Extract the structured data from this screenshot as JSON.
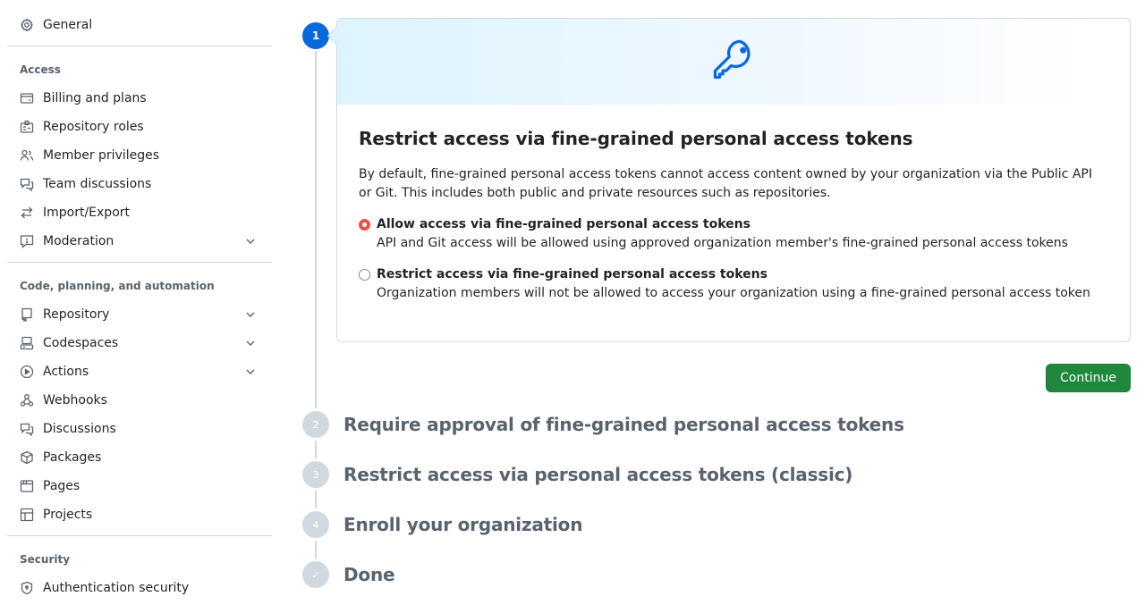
{
  "sidebar": {
    "top_item": {
      "label": "General",
      "icon": "gear-icon"
    },
    "sections": [
      {
        "heading": "Access",
        "items": [
          {
            "label": "Billing and plans",
            "icon": "credit-card-icon",
            "expandable": false
          },
          {
            "label": "Repository roles",
            "icon": "id-badge-icon",
            "expandable": false
          },
          {
            "label": "Member privileges",
            "icon": "people-icon",
            "expandable": false
          },
          {
            "label": "Team discussions",
            "icon": "comment-discussion-icon",
            "expandable": false
          },
          {
            "label": "Import/Export",
            "icon": "arrow-switch-icon",
            "expandable": false
          },
          {
            "label": "Moderation",
            "icon": "report-icon",
            "expandable": true
          }
        ]
      },
      {
        "heading": "Code, planning, and automation",
        "items": [
          {
            "label": "Repository",
            "icon": "repo-icon",
            "expandable": true
          },
          {
            "label": "Codespaces",
            "icon": "codespaces-icon",
            "expandable": true
          },
          {
            "label": "Actions",
            "icon": "play-icon",
            "expandable": true
          },
          {
            "label": "Webhooks",
            "icon": "webhook-icon",
            "expandable": false
          },
          {
            "label": "Discussions",
            "icon": "comment-discussion-icon",
            "expandable": false
          },
          {
            "label": "Packages",
            "icon": "package-icon",
            "expandable": false
          },
          {
            "label": "Pages",
            "icon": "browser-icon",
            "expandable": false
          },
          {
            "label": "Projects",
            "icon": "table-icon",
            "expandable": false
          }
        ]
      },
      {
        "heading": "Security",
        "items": [
          {
            "label": "Authentication security",
            "icon": "shield-lock-icon",
            "expandable": false
          }
        ]
      }
    ]
  },
  "wizard": {
    "active_step": {
      "number": "1",
      "hero_icon": "key-icon",
      "title": "Restrict access via fine-grained personal access tokens",
      "description": "By default, fine-grained personal access tokens cannot access content owned by your organization via the Public API or Git. This includes both public and private resources such as repositories.",
      "options": [
        {
          "title": "Allow access via fine-grained personal access tokens",
          "description": "API and Git access will be allowed using approved organization member's fine-grained personal access tokens",
          "checked": true
        },
        {
          "title": "Restrict access via fine-grained personal access tokens",
          "description": "Organization members will not be allowed to access your organization using a fine-grained personal access token",
          "checked": false
        }
      ],
      "continue_label": "Continue"
    },
    "pending_steps": [
      {
        "number": "2",
        "title": "Require approval of fine-grained personal access tokens"
      },
      {
        "number": "3",
        "title": "Restrict access via personal access tokens (classic)"
      },
      {
        "number": "4",
        "title": "Enroll your organization"
      },
      {
        "number": "✓",
        "title": "Done"
      }
    ]
  },
  "colors": {
    "accent_blue": "#0969da",
    "primary_green": "#1f883d",
    "radio_checked": "#e5534b",
    "muted": "#59636e"
  }
}
